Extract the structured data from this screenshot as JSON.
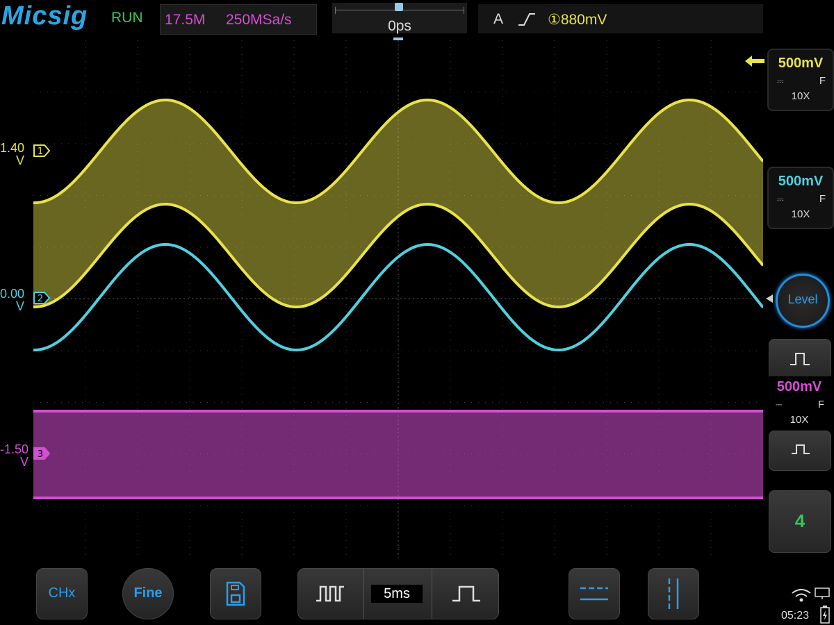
{
  "header": {
    "logo": "Micsig",
    "run_state": "RUN",
    "memory_depth": "17.5M",
    "sample_rate": "250MSa/s",
    "horizontal_position": "0ps",
    "trigger_mode": "A",
    "trigger_level": "①880mV"
  },
  "channels": [
    {
      "id": "1",
      "offset_label": "1.40",
      "unit": "V",
      "color": "#e8e34a",
      "scale": "500mV",
      "coupling_icon": "dc-coupling-icon",
      "bandwidth": "F",
      "probe": "10X"
    },
    {
      "id": "2",
      "offset_label": "0.00",
      "unit": "V",
      "color": "#4fd0e0",
      "scale": "500mV",
      "coupling_icon": "dc-coupling-icon",
      "bandwidth": "F",
      "probe": "10X"
    },
    {
      "id": "3",
      "offset_label": "-1.50",
      "unit": "V",
      "color": "#d34fd3",
      "scale": "500mV",
      "coupling_icon": "dc-coupling-icon",
      "bandwidth": "F",
      "probe": "10X"
    }
  ],
  "right_panel": {
    "level_button": "Level",
    "ch4_button": "4"
  },
  "toolbar": {
    "chx_button": "CHx",
    "fine_button": "Fine",
    "timebase": "5ms"
  },
  "status_bar": {
    "time": "05:23"
  },
  "colors": {
    "ch1": "#e8e34a",
    "ch2": "#4fd0e0",
    "ch3": "#d34fd3",
    "accent": "#2e9de8"
  }
}
